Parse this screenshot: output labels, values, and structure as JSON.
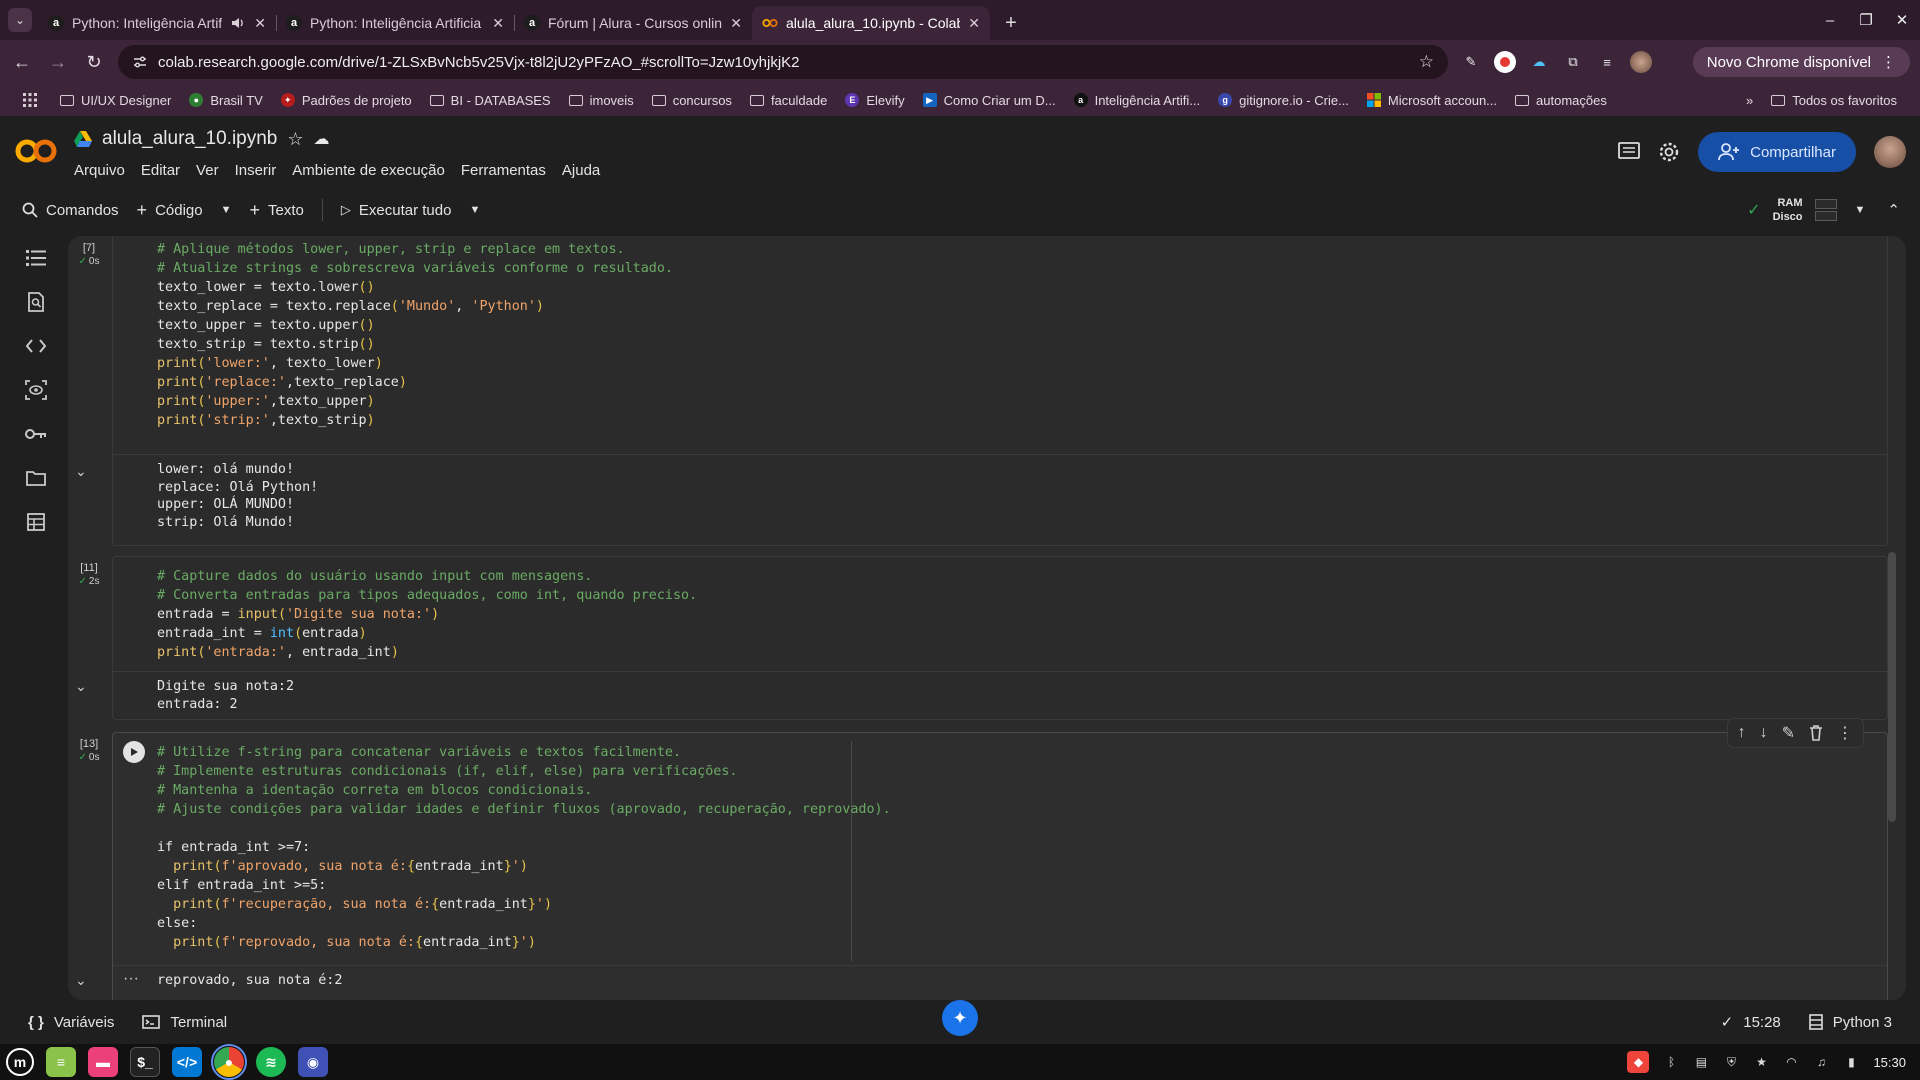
{
  "browser": {
    "tabs": [
      {
        "title": "Python: Inteligência Artif",
        "icon": "alura-icon",
        "has_audio": true,
        "active": false
      },
      {
        "title": "Python: Inteligência Artificia",
        "icon": "alura-icon",
        "active": false
      },
      {
        "title": "Fórum | Alura - Cursos online",
        "icon": "alura-icon",
        "active": false
      },
      {
        "title": "alula_alura_10.ipynb - Colab",
        "icon": "colab-icon",
        "active": true
      }
    ],
    "url": "colab.research.google.com/drive/1-ZLSxBvNcb5v25Vjx-t8l2jU2yPFzAO_#scrollTo=Jzw10yhjkjK2",
    "update_button": "Novo Chrome disponível",
    "bookmarks": [
      {
        "label": "UI/UX Designer",
        "type": "folder"
      },
      {
        "label": "Brasil TV",
        "type": "site"
      },
      {
        "label": "Padrões de projeto",
        "type": "site"
      },
      {
        "label": "BI - DATABASES",
        "type": "folder"
      },
      {
        "label": "imoveis",
        "type": "folder"
      },
      {
        "label": "concursos",
        "type": "folder"
      },
      {
        "label": "faculdade",
        "type": "folder"
      },
      {
        "label": "Elevify",
        "type": "site"
      },
      {
        "label": "Como Criar um D...",
        "type": "site"
      },
      {
        "label": "Inteligência Artifi...",
        "type": "site"
      },
      {
        "label": "gitignore.io - Crie...",
        "type": "site"
      },
      {
        "label": "Microsoft accoun...",
        "type": "site"
      },
      {
        "label": "automações",
        "type": "folder"
      }
    ],
    "all_bookmarks": "Todos os favoritos"
  },
  "colab": {
    "notebook_title": "alula_alura_10.ipynb",
    "menu": [
      "Arquivo",
      "Editar",
      "Ver",
      "Inserir",
      "Ambiente de execução",
      "Ferramentas",
      "Ajuda"
    ],
    "share_label": "Compartilhar",
    "toolbar": {
      "commands": "Comandos",
      "code": "Código",
      "text": "Texto",
      "run_all": "Executar tudo",
      "ram": "RAM",
      "disk": "Disco"
    },
    "cells": [
      {
        "exec_count": "[7]",
        "duration": "0s",
        "code": [
          [
            {
              "t": "# Aplique métodos lower, upper, strip e replace em textos.",
              "k": "c"
            }
          ],
          [
            {
              "t": "# Atualize strings e sobrescreva variáveis conforme o resultado.",
              "k": "c"
            }
          ],
          [
            {
              "t": "texto_lower = texto.lower",
              "k": ""
            },
            {
              "t": "()",
              "k": "br"
            }
          ],
          [
            {
              "t": "texto_replace = texto.replace",
              "k": ""
            },
            {
              "t": "(",
              "k": "br"
            },
            {
              "t": "'Mundo'",
              "k": "s"
            },
            {
              "t": ", ",
              "k": ""
            },
            {
              "t": "'Python'",
              "k": "s"
            },
            {
              "t": ")",
              "k": "br"
            }
          ],
          [
            {
              "t": "texto_upper = texto.upper",
              "k": ""
            },
            {
              "t": "()",
              "k": "br"
            }
          ],
          [
            {
              "t": "texto_strip = texto.strip",
              "k": ""
            },
            {
              "t": "()",
              "k": "br"
            }
          ],
          [
            {
              "t": "print",
              "k": "fn"
            },
            {
              "t": "(",
              "k": "br"
            },
            {
              "t": "'lower:'",
              "k": "s"
            },
            {
              "t": ", texto_lower",
              "k": ""
            },
            {
              "t": ")",
              "k": "br"
            }
          ],
          [
            {
              "t": "print",
              "k": "fn"
            },
            {
              "t": "(",
              "k": "br"
            },
            {
              "t": "'replace:'",
              "k": "s"
            },
            {
              "t": ",texto_replace",
              "k": ""
            },
            {
              "t": ")",
              "k": "br"
            }
          ],
          [
            {
              "t": "print",
              "k": "fn"
            },
            {
              "t": "(",
              "k": "br"
            },
            {
              "t": "'upper:'",
              "k": "s"
            },
            {
              "t": ",texto_upper",
              "k": ""
            },
            {
              "t": ")",
              "k": "br"
            }
          ],
          [
            {
              "t": "print",
              "k": "fn"
            },
            {
              "t": "(",
              "k": "br"
            },
            {
              "t": "'strip:'",
              "k": "s"
            },
            {
              "t": ",texto_strip",
              "k": ""
            },
            {
              "t": ")",
              "k": "br"
            }
          ]
        ],
        "output": "lower: olá mundo!\nreplace: Olá Python!\nupper: OLÁ MUNDO!\nstrip: Olá Mundo!"
      },
      {
        "exec_count": "[11]",
        "duration": "2s",
        "code": [
          [
            {
              "t": "# Capture dados do usuário usando input com mensagens.",
              "k": "c"
            }
          ],
          [
            {
              "t": "# Converta entradas para tipos adequados, como int, quando preciso.",
              "k": "c"
            }
          ],
          [
            {
              "t": "entrada = ",
              "k": ""
            },
            {
              "t": "input",
              "k": "fn"
            },
            {
              "t": "(",
              "k": "br"
            },
            {
              "t": "'Digite sua nota:'",
              "k": "s"
            },
            {
              "t": ")",
              "k": "br"
            }
          ],
          [
            {
              "t": "entrada_int = ",
              "k": ""
            },
            {
              "t": "int",
              "k": "bi"
            },
            {
              "t": "(",
              "k": "br"
            },
            {
              "t": "entrada",
              "k": ""
            },
            {
              "t": ")",
              "k": "br"
            }
          ],
          [
            {
              "t": "print",
              "k": "fn"
            },
            {
              "t": "(",
              "k": "br"
            },
            {
              "t": "'entrada:'",
              "k": "s"
            },
            {
              "t": ", entrada_int",
              "k": ""
            },
            {
              "t": ")",
              "k": "br"
            }
          ]
        ],
        "output": "Digite sua nota:2\nentrada: 2"
      },
      {
        "exec_count": "[13]",
        "duration": "0s",
        "code": [
          [
            {
              "t": "# Utilize f-string para concatenar variáveis e textos facilmente.",
              "k": "c"
            }
          ],
          [
            {
              "t": "# Implemente estruturas condicionais (if, elif, else) para verificações.",
              "k": "c"
            }
          ],
          [
            {
              "t": "# Mantenha a identação correta em blocos condicionais.",
              "k": "c"
            }
          ],
          [
            {
              "t": "# Ajuste condições para validar idades e definir fluxos (aprovado, recuperação, reprovado).",
              "k": "c"
            }
          ],
          [
            {
              "t": "",
              "k": ""
            }
          ],
          [
            {
              "t": "if entrada_int >=7:",
              "k": ""
            }
          ],
          [
            {
              "t": "  ",
              "k": ""
            },
            {
              "t": "print",
              "k": "fn"
            },
            {
              "t": "(",
              "k": "br"
            },
            {
              "t": "f'aprovado, sua nota é:",
              "k": "s"
            },
            {
              "t": "{",
              "k": "br"
            },
            {
              "t": "entrada_int",
              "k": ""
            },
            {
              "t": "}",
              "k": "br"
            },
            {
              "t": "'",
              "k": "s"
            },
            {
              "t": ")",
              "k": "br"
            }
          ],
          [
            {
              "t": "elif entrada_int >=5:",
              "k": ""
            }
          ],
          [
            {
              "t": "  ",
              "k": ""
            },
            {
              "t": "print",
              "k": "fn"
            },
            {
              "t": "(",
              "k": "br"
            },
            {
              "t": "f'recuperação, sua nota é:",
              "k": "s"
            },
            {
              "t": "{",
              "k": "br"
            },
            {
              "t": "entrada_int",
              "k": ""
            },
            {
              "t": "}",
              "k": "br"
            },
            {
              "t": "'",
              "k": "s"
            },
            {
              "t": ")",
              "k": "br"
            }
          ],
          [
            {
              "t": "else:",
              "k": ""
            }
          ],
          [
            {
              "t": "  ",
              "k": ""
            },
            {
              "t": "print",
              "k": "fn"
            },
            {
              "t": "(",
              "k": "br"
            },
            {
              "t": "f'reprovado, sua nota é:",
              "k": "s"
            },
            {
              "t": "{",
              "k": "br"
            },
            {
              "t": "entrada_int",
              "k": ""
            },
            {
              "t": "}",
              "k": "br"
            },
            {
              "t": "'",
              "k": "s"
            },
            {
              "t": ")",
              "k": "br"
            }
          ]
        ],
        "output": "reprovado, sua nota é:2"
      }
    ],
    "status": {
      "variables": "Variáveis",
      "terminal": "Terminal",
      "time": "15:28",
      "runtime": "Python 3"
    }
  },
  "os": {
    "clock": "15:30"
  },
  "colors": {
    "tabstrip": "#2d1a2b",
    "browser_toolbar": "#3c2539",
    "colab_bg": "#1f1f1f",
    "cell_bg": "#2b2b2b",
    "share_button": "#174ea6",
    "comment": "#6aaa64",
    "string": "#f0a46a",
    "function": "#e8c26b"
  }
}
